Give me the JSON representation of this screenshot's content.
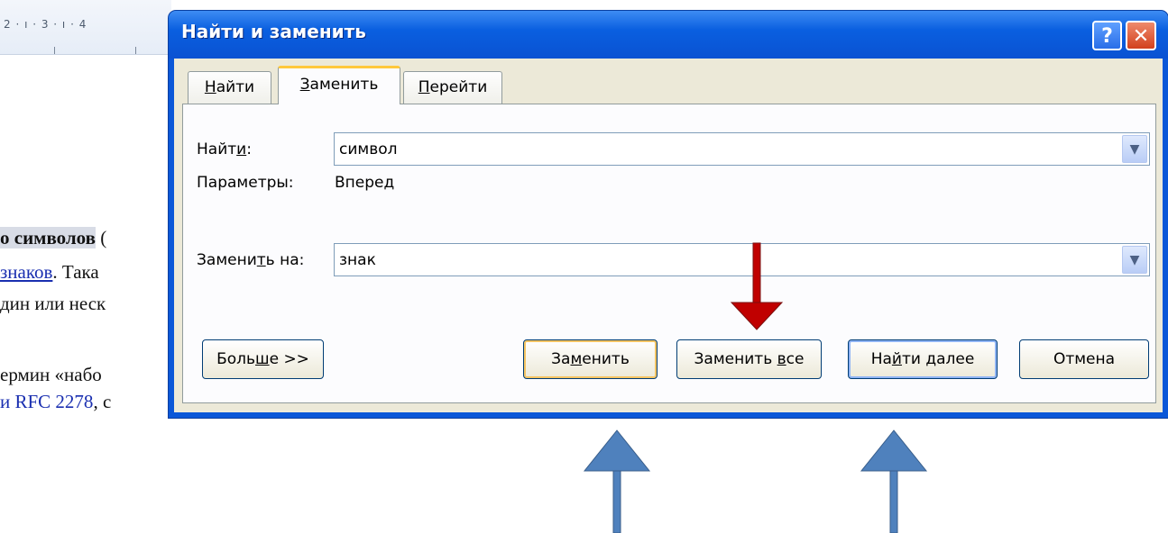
{
  "background_doc": {
    "ruler_text": "2 · ı · 3 · ı · 4",
    "line1_bold": "о символов",
    "line1_rest": " (",
    "line2_link": "знаков",
    "line2_prefix": "",
    "line2_rest": ". Така",
    "line3": "дин или неск",
    "line4": "ермин «набо",
    "line5_link": "и RFC 2278",
    "line5_rest": ", с"
  },
  "dialog": {
    "title": "Найти и заменить",
    "help_glyph": "?",
    "close_glyph": "✕",
    "tabs": [
      {
        "label_pre": "",
        "label_u": "Н",
        "label_post": "айти"
      },
      {
        "label_pre": "",
        "label_u": "З",
        "label_post": "аменить"
      },
      {
        "label_pre": "",
        "label_u": "П",
        "label_post": "ерейти"
      }
    ],
    "find": {
      "label_pre": "Найт",
      "label_u": "и",
      "label_post": ":",
      "value": "символ"
    },
    "options": {
      "label": "Параметры:",
      "value": "Вперед"
    },
    "replace": {
      "label_pre": "Замени",
      "label_u": "т",
      "label_post": "ь на:",
      "value": "знак"
    },
    "buttons": {
      "more": {
        "pre": "Боль",
        "u": "ш",
        "post": "е >>"
      },
      "replace": {
        "pre": "За",
        "u": "м",
        "post": "енить"
      },
      "replace_all": {
        "pre": "Заменить ",
        "u": "в",
        "post": "се"
      },
      "find_next": {
        "pre": "На",
        "u": "й",
        "post": "ти далее"
      },
      "cancel": "Отмена"
    }
  },
  "colors": {
    "title_bar": "#0a5fe0",
    "dialog_face": "#ece9d8",
    "red_arrow": "#c00000",
    "blue_arrow": "#4f81bd"
  }
}
